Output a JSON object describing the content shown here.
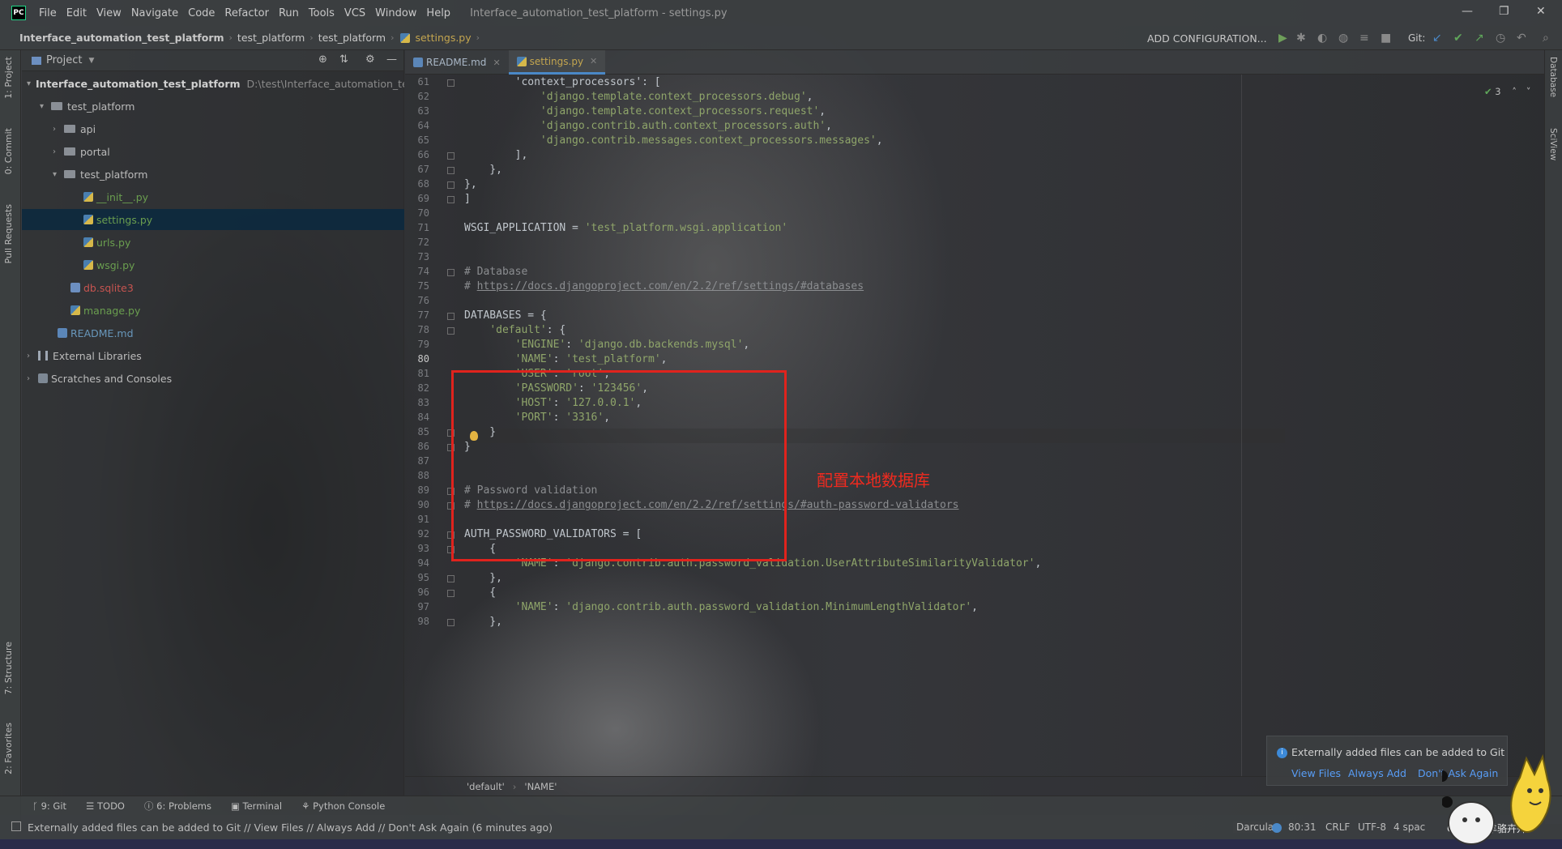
{
  "menu": {
    "items": [
      "File",
      "Edit",
      "View",
      "Navigate",
      "Code",
      "Refactor",
      "Run",
      "Tools",
      "VCS",
      "Window",
      "Help"
    ],
    "window_title": "Interface_automation_test_platform - settings.py"
  },
  "nav": {
    "crumbs": [
      "Interface_automation_test_platform",
      "test_platform",
      "test_platform",
      "settings.py"
    ],
    "add_configuration": "ADD CONFIGURATION...",
    "git_label": "Git:"
  },
  "left_strip": {
    "project": "1: Project",
    "commit": "0: Commit",
    "pull_requests": "Pull Requests",
    "structure": "7: Structure",
    "favorites": "2: Favorites"
  },
  "right_strip": {
    "database": "Database",
    "sciview": "SciView"
  },
  "project_panel": {
    "header": "Project",
    "root_name": "Interface_automation_test_platform",
    "root_path": "D:\\test\\Interface_automation_test_p",
    "items": {
      "test_platform_outer": "test_platform",
      "api": "api",
      "portal": "portal",
      "test_platform_inner": "test_platform",
      "init": "__init__.py",
      "settings": "settings.py",
      "urls": "urls.py",
      "wsgi": "wsgi.py",
      "db": "db.sqlite3",
      "manage": "manage.py",
      "readme": "README.md",
      "external_libraries": "External Libraries",
      "scratches": "Scratches and Consoles"
    }
  },
  "editor": {
    "tabs": [
      "README.md",
      "settings.py"
    ],
    "inspection_count": "3",
    "line_numbers": [
      "61",
      "62",
      "63",
      "64",
      "65",
      "66",
      "67",
      "68",
      "69",
      "70",
      "71",
      "72",
      "73",
      "74",
      "75",
      "76",
      "77",
      "78",
      "79",
      "80",
      "81",
      "82",
      "83",
      "84",
      "85",
      "86",
      "87",
      "88",
      "89",
      "90",
      "91",
      "92",
      "93",
      "94",
      "95",
      "96",
      "97",
      "98"
    ],
    "lines": {
      "l61a": "        'context_processors': [",
      "l62a": "            ",
      "l62s": "'django.template.context_processors.debug'",
      "l62b": ",",
      "l63s": "'django.template.context_processors.request'",
      "l64s": "'django.contrib.auth.context_processors.auth'",
      "l65s": "'django.contrib.messages.context_processors.messages'",
      "l66": "        ],",
      "l67": "    },",
      "l68": "},",
      "l69": "]",
      "l71a": "WSGI_APPLICATION = ",
      "l71s": "'test_platform.wsgi.application'",
      "l74": "# Database",
      "l75a": "# ",
      "l75u": "https://docs.djangoproject.com/en/2.2/ref/settings/#databases",
      "l77": "DATABASES = {",
      "l78s": "'default'",
      "l78b": ": {",
      "l79k": "'ENGINE'",
      "l79v": "'django.db.backends.mysql'",
      "l80k": "'NAME'",
      "l80v": "'test_platform'",
      "l81k": "'USER'",
      "l81v": "'root'",
      "l82k": "'PASSWORD'",
      "l82v": "'123456'",
      "l83k": "'HOST'",
      "l83v": "'127.0.0.1'",
      "l84k": "'PORT'",
      "l84v": "'3316'",
      "l85": "    }",
      "l86": "}",
      "l89": "# Password validation",
      "l90a": "# ",
      "l90u": "https://docs.djangoproject.com/en/2.2/ref/settings/#auth-password-validators",
      "l92": "AUTH_PASSWORD_VALIDATORS = [",
      "l93": "    {",
      "l94k": "'NAME'",
      "l94v": "'django.contrib.auth.password_validation.UserAttributeSimilarityValidator'",
      "l95": "    },",
      "l96": "    {",
      "l97k": "'NAME'",
      "l97v": "'django.contrib.auth.password_validation.MinimumLengthValidator'",
      "l98": "    },"
    },
    "annotation": "配置本地数据库",
    "breadcrumb": [
      "'default'",
      "'NAME'"
    ]
  },
  "tool_tabs": [
    "9: Git",
    "TODO",
    "6: Problems",
    "Terminal",
    "Python Console"
  ],
  "status": {
    "message": "Externally added files can be added to Git // View Files // Always Add // Don't Ask Again (6 minutes ago)",
    "theme": "Darcula",
    "position": "80:31",
    "line_sep": "CRLF",
    "encoding": "UTF-8",
    "indent": "4 spac",
    "watermark": "CSDN @羊骆卉卉"
  },
  "notification": {
    "text": "Externally added files can be added to Git",
    "view_files": "View Files",
    "always_add": "Always Add",
    "dont_ask": "Don't Ask Again"
  },
  "colors": {
    "string": "#8fa56a",
    "comment": "#8b8d90",
    "highlight_box": "#e0231d",
    "annotation": "#f02a1f",
    "selection": "#0d293e",
    "link": "#589df6"
  }
}
